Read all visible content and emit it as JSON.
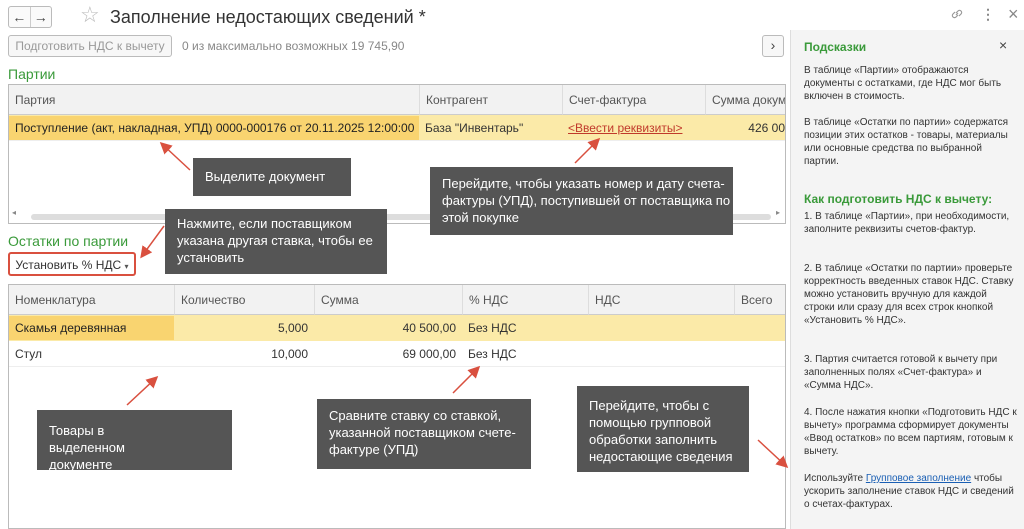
{
  "window": {
    "title": "Заполнение недостающих сведений *",
    "back_icon": "←",
    "forward_icon": "→",
    "star_icon": "☆",
    "link_icon": "🔗",
    "more_icon": "⋮",
    "close_icon": "×"
  },
  "toolbar": {
    "prepare_button": "Подготовить НДС к вычету",
    "counter": "0 из максимально возможных 19 745,90",
    "next_button": "›"
  },
  "batches": {
    "section_title": "Партии",
    "columns": [
      "Партия",
      "Контрагент",
      "Счет-фактура",
      "Сумма докуме"
    ],
    "rows": [
      {
        "batch": "Поступление (акт, накладная, УПД) 0000-000176 от 20.11.2025 12:00:00",
        "counterparty": "База \"Инвентарь\"",
        "invoice": "<Ввести реквизиты>",
        "sum": "426 00"
      }
    ]
  },
  "leftovers": {
    "section_title": "Остатки по партии",
    "set_vat_button": "Установить % НДС",
    "columns": [
      "Номенклатура",
      "Количество",
      "Сумма",
      "% НДС",
      "НДС",
      "Всего"
    ],
    "rows": [
      {
        "name": "Скамья деревянная",
        "qty": "5,000",
        "sum": "40 500,00",
        "vat_rate": "Без НДС",
        "vat": "",
        "total": ""
      },
      {
        "name": "Стул",
        "qty": "10,000",
        "sum": "69 000,00",
        "vat_rate": "Без НДС",
        "vat": "",
        "total": ""
      }
    ]
  },
  "tips": {
    "select_doc": "Выделите документ",
    "enter_invoice": "Перейдите, чтобы указать номер и дату счета-фактуры (УПД), поступившей от поставщика по этой покупке",
    "other_rate": "Нажмите, если поставщиком указана другая ставка, чтобы ее установить",
    "goods": "Товары в выделенном документе",
    "compare_rate": "Сравните ставку со ставкой, указанной поставщиком счете-фактуре (УПД)",
    "group_fill": "Перейдите, чтобы с помощью групповой обработки заполнить недостающие сведения"
  },
  "hints": {
    "title": "Подсказки",
    "close": "×",
    "p1": "В таблице «Партии» отображаются документы с остатками, где НДС мог быть включен в стоимость.",
    "p2": "В таблице «Остатки по партии» содержатся позиции этих остатков - товары, материалы или основные средства по выбранной партии.",
    "how_title": "Как подготовить НДС к вычету:",
    "s1": "1. В таблице «Партии», при необходимости, заполните реквизиты счетов-фактур.",
    "s2": "2. В таблице «Остатки по партии» проверьте корректность введенных ставок НДС. Ставку можно установить вручную для каждой строки или сразу для всех строк кнопкой «Установить % НДС».",
    "s3": "3. Партия считается готовой к вычету при заполненных полях «Счет-фактура» и «Сумма НДС».",
    "s4": "4. После нажатия кнопки «Подготовить НДС к вычету» программа сформирует документы «Ввод остатков» по всем партиям, готовым к вычету.",
    "use_prefix": "Используйте",
    "use_link": "Групповое заполнение",
    "use_suffix": "чтобы ускорить заполнение ставок НДС и сведений о счетах-фактурах."
  },
  "colors": {
    "accent_green": "#3a9a3a",
    "selected_row": "#fbeaa8",
    "tip_bg": "#555555",
    "arrow": "#d9503f"
  }
}
